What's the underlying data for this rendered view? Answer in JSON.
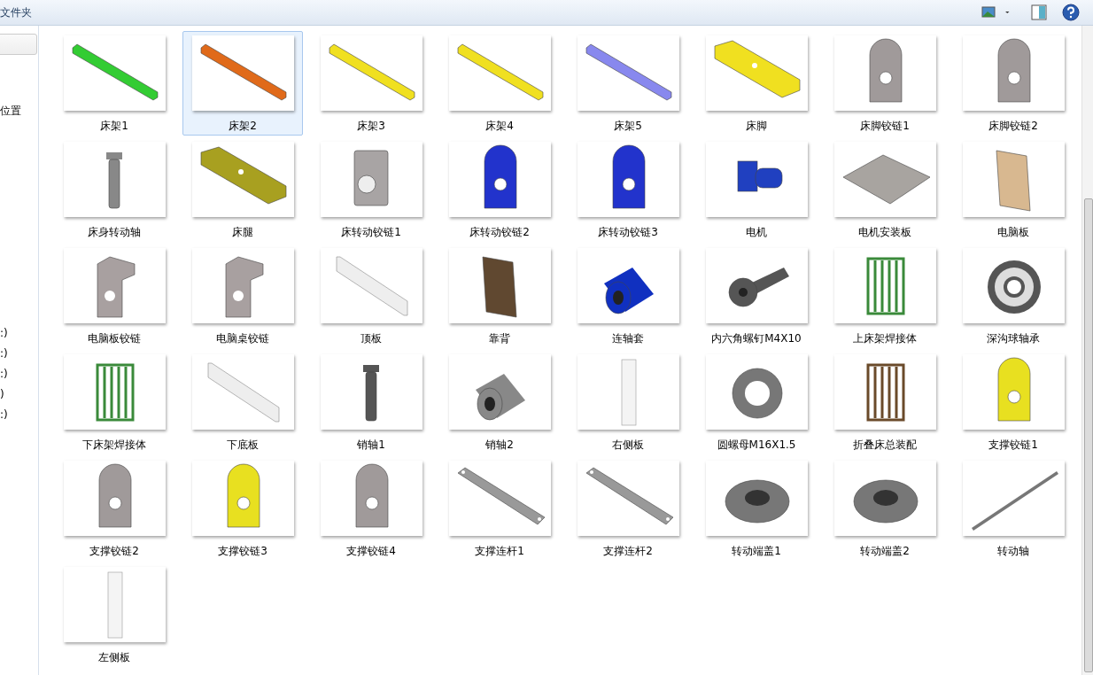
{
  "toolbar": {
    "title": "文件夹"
  },
  "sidebar": {
    "items": [
      {
        "text": "位置"
      },
      {
        "text": ":)"
      },
      {
        "text": ":)"
      },
      {
        "text": ":)"
      },
      {
        "text": ")"
      },
      {
        "text": ":)"
      }
    ]
  },
  "items": [
    {
      "name": "床架1",
      "kind": "bar",
      "color": "#33cc33",
      "selected": false
    },
    {
      "name": "床架2",
      "kind": "bar",
      "color": "#e06a1a",
      "selected": true
    },
    {
      "name": "床架3",
      "kind": "bar",
      "color": "#f0e020",
      "selected": false
    },
    {
      "name": "床架4",
      "kind": "bar",
      "color": "#f0e020",
      "selected": false
    },
    {
      "name": "床架5",
      "kind": "bar",
      "color": "#8888ee",
      "selected": false
    },
    {
      "name": "床脚",
      "kind": "beam",
      "color": "#f0e020",
      "selected": false
    },
    {
      "name": "床脚铰链1",
      "kind": "hinge",
      "color": "#a09a9a",
      "selected": false
    },
    {
      "name": "床脚铰链2",
      "kind": "hinge",
      "color": "#a09a9a",
      "selected": false
    },
    {
      "name": "床身转动轴",
      "kind": "shaft",
      "color": "#888888",
      "selected": false
    },
    {
      "name": "床腿",
      "kind": "beam",
      "color": "#a8a020",
      "selected": false
    },
    {
      "name": "床转动铰链1",
      "kind": "block",
      "color": "#a8a4a4",
      "selected": false
    },
    {
      "name": "床转动铰链2",
      "kind": "hinge",
      "color": "#2233cc",
      "selected": false
    },
    {
      "name": "床转动铰链3",
      "kind": "hinge",
      "color": "#2233cc",
      "selected": false
    },
    {
      "name": "电机",
      "kind": "motor",
      "color": "#2040c0",
      "selected": false
    },
    {
      "name": "电机安装板",
      "kind": "plate",
      "color": "#a8a4a0",
      "selected": false
    },
    {
      "name": "电脑板",
      "kind": "panel",
      "color": "#d8b890",
      "selected": false
    },
    {
      "name": "电脑板铰链",
      "kind": "bracket",
      "color": "#a8a0a0",
      "selected": false
    },
    {
      "name": "电脑桌铰链",
      "kind": "bracket",
      "color": "#a8a0a0",
      "selected": false
    },
    {
      "name": "顶板",
      "kind": "sheet",
      "color": "#eeeeee",
      "selected": false
    },
    {
      "name": "靠背",
      "kind": "panel",
      "color": "#604830",
      "selected": false
    },
    {
      "name": "连轴套",
      "kind": "cylinder",
      "color": "#1030c0",
      "selected": false
    },
    {
      "name": "内六角螺钉M4X10",
      "kind": "screw",
      "color": "#555555",
      "selected": false
    },
    {
      "name": "上床架焊接体",
      "kind": "frame",
      "color": "#3a8a3a",
      "selected": false
    },
    {
      "name": "深沟球轴承",
      "kind": "bearing",
      "color": "#555555",
      "selected": false
    },
    {
      "name": "下床架焊接体",
      "kind": "frame",
      "color": "#3a8a3a",
      "selected": false
    },
    {
      "name": "下底板",
      "kind": "sheet",
      "color": "#eeeeee",
      "selected": false
    },
    {
      "name": "销轴1",
      "kind": "shaft",
      "color": "#555555",
      "selected": false
    },
    {
      "name": "销轴2",
      "kind": "cylinder",
      "color": "#888888",
      "selected": false
    },
    {
      "name": "右侧板",
      "kind": "strip",
      "color": "#f4f4f4",
      "selected": false
    },
    {
      "name": "圆螺母M16X1.5",
      "kind": "nut",
      "color": "#777777",
      "selected": false
    },
    {
      "name": "折叠床总装配",
      "kind": "frame",
      "color": "#6a4a2a",
      "selected": false
    },
    {
      "name": "支撑铰链1",
      "kind": "hinge",
      "color": "#e8e020",
      "selected": false
    },
    {
      "name": "支撑铰链2",
      "kind": "hinge",
      "color": "#a09a9a",
      "selected": false
    },
    {
      "name": "支撑铰链3",
      "kind": "hinge",
      "color": "#e8e020",
      "selected": false
    },
    {
      "name": "支撑铰链4",
      "kind": "hinge",
      "color": "#a09a9a",
      "selected": false
    },
    {
      "name": "支撑连杆1",
      "kind": "link",
      "color": "#999999",
      "selected": false
    },
    {
      "name": "支撑连杆2",
      "kind": "link",
      "color": "#999999",
      "selected": false
    },
    {
      "name": "转动端盖1",
      "kind": "flange",
      "color": "#777777",
      "selected": false
    },
    {
      "name": "转动端盖2",
      "kind": "flange",
      "color": "#777777",
      "selected": false
    },
    {
      "name": "转动轴",
      "kind": "rod",
      "color": "#777777",
      "selected": false
    },
    {
      "name": "左侧板",
      "kind": "strip",
      "color": "#f4f4f4",
      "selected": false
    }
  ]
}
